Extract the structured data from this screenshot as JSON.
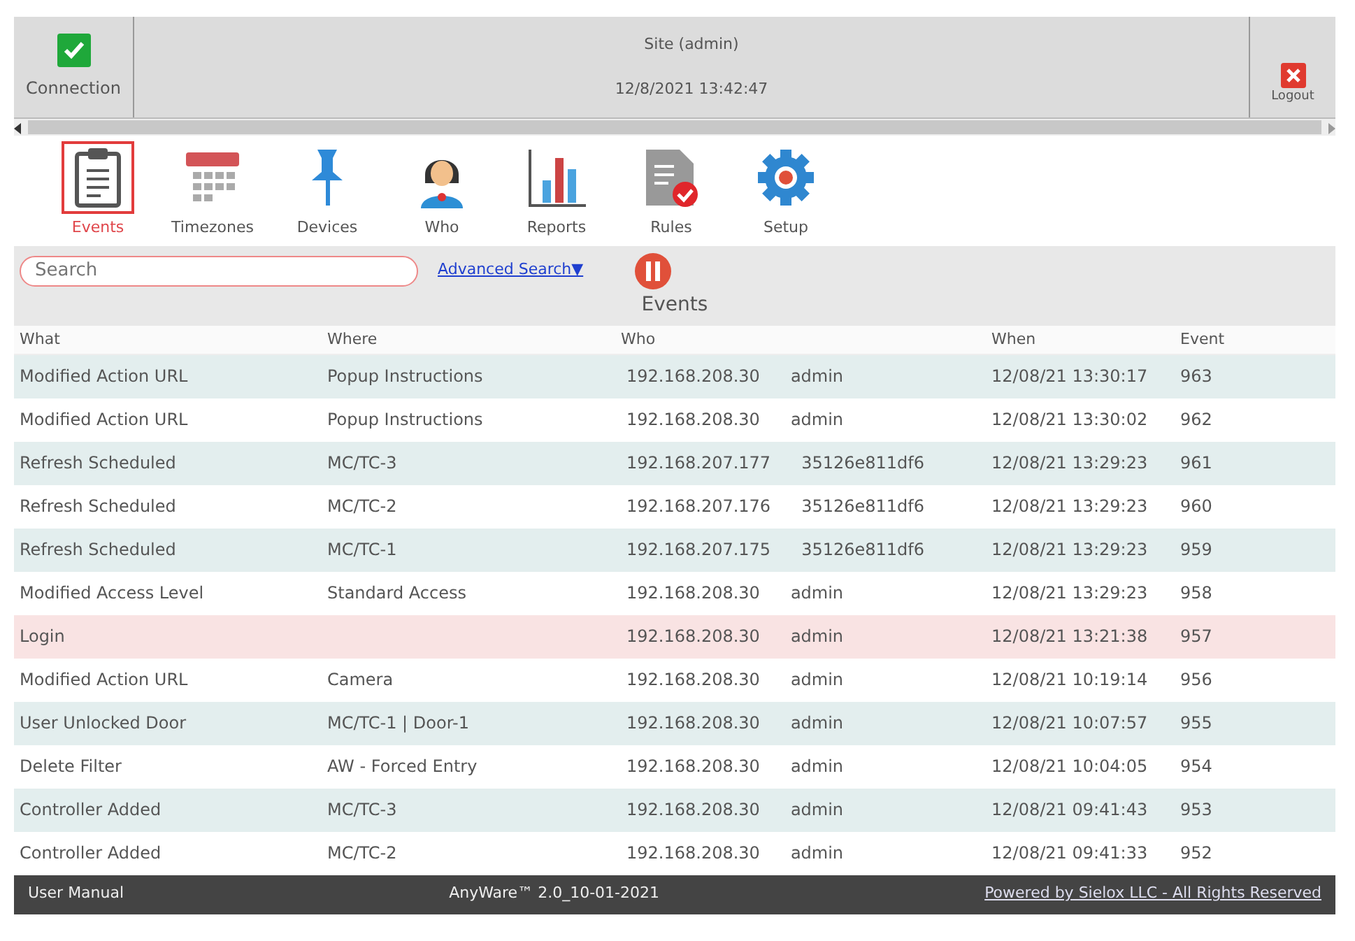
{
  "header": {
    "connection": {
      "label": "Connection",
      "connected": true
    },
    "site": "Site (admin)",
    "datetime": "12/8/2021 13:42:47",
    "logout": "Logout"
  },
  "nav": [
    {
      "label": "Events",
      "kind": "clipboard",
      "selected": true
    },
    {
      "label": "Timezones",
      "kind": "calendar",
      "selected": false
    },
    {
      "label": "Devices",
      "kind": "pin",
      "selected": false
    },
    {
      "label": "Who",
      "kind": "person",
      "selected": false
    },
    {
      "label": "Reports",
      "kind": "chart",
      "selected": false
    },
    {
      "label": "Rules",
      "kind": "rules",
      "selected": false
    },
    {
      "label": "Setup",
      "kind": "gear",
      "selected": false
    }
  ],
  "search": {
    "placeholder": "Search",
    "advanced": "Advanced Search▼"
  },
  "table": {
    "title": "Events",
    "columns": [
      "What",
      "Where",
      "Who",
      "When",
      "Event"
    ],
    "rows": [
      {
        "what": "Modified Action URL",
        "where": "Popup Instructions",
        "ip": "192.168.208.30",
        "user": "admin",
        "when": "12/08/21 13:30:17",
        "event": "963",
        "color": "#e3eeee"
      },
      {
        "what": "Modified Action URL",
        "where": "Popup Instructions",
        "ip": "192.168.208.30",
        "user": "admin",
        "when": "12/08/21 13:30:02",
        "event": "962",
        "color": "#ffffff"
      },
      {
        "what": "Refresh Scheduled",
        "where": "MC/TC-3",
        "ip": "192.168.207.177",
        "user": "35126e811df6",
        "when": "12/08/21 13:29:23",
        "event": "961",
        "color": "#e3eeee"
      },
      {
        "what": "Refresh Scheduled",
        "where": "MC/TC-2",
        "ip": "192.168.207.176",
        "user": "35126e811df6",
        "when": "12/08/21 13:29:23",
        "event": "960",
        "color": "#ffffff"
      },
      {
        "what": "Refresh Scheduled",
        "where": "MC/TC-1",
        "ip": "192.168.207.175",
        "user": "35126e811df6",
        "when": "12/08/21 13:29:23",
        "event": "959",
        "color": "#e3eeee"
      },
      {
        "what": "Modified Access Level",
        "where": "Standard Access",
        "ip": "192.168.208.30",
        "user": "admin",
        "when": "12/08/21 13:29:23",
        "event": "958",
        "color": "#ffffff"
      },
      {
        "what": "Login",
        "ip": "192.168.208.30",
        "user": "admin",
        "when": "12/08/21 13:21:38",
        "event": "957",
        "color": "#f9e3e3"
      },
      {
        "what": "Modified Action URL",
        "where": "Camera",
        "ip": "192.168.208.30",
        "user": "admin",
        "when": "12/08/21 10:19:14",
        "event": "956",
        "color": "#ffffff"
      },
      {
        "what": "User Unlocked Door",
        "where": "MC/TC-1 | Door-1",
        "ip": "192.168.208.30",
        "user": "admin",
        "when": "12/08/21 10:07:57",
        "event": "955",
        "color": "#e3eeee"
      },
      {
        "what": "Delete Filter",
        "where": "AW - Forced Entry",
        "ip": "192.168.208.30",
        "user": "admin",
        "when": "12/08/21 10:04:05",
        "event": "954",
        "color": "#ffffff"
      },
      {
        "what": "Controller Added",
        "where": "MC/TC-3",
        "ip": "192.168.208.30",
        "user": "admin",
        "when": "12/08/21 09:41:43",
        "event": "953",
        "color": "#e3eeee"
      },
      {
        "what": "Controller Added",
        "where": "MC/TC-2",
        "ip": "192.168.208.30",
        "user": "admin",
        "when": "12/08/21 09:41:33",
        "event": "952",
        "color": "#ffffff"
      }
    ]
  },
  "footer": {
    "manual": "User Manual",
    "version": "AnyWare™ 2.0_10-01-2021",
    "powered": "Powered by Sielox LLC - All Rights Reserved"
  }
}
